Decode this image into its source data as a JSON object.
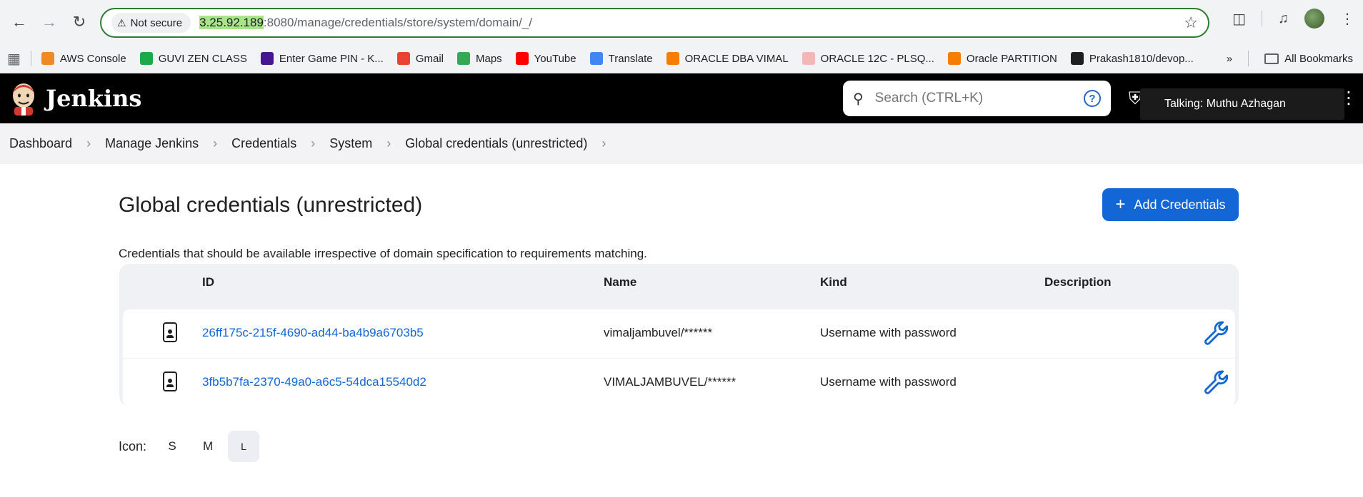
{
  "browser": {
    "security_label": "Not secure",
    "url_host": "3.25.92.189",
    "url_rest": ":8080/manage/credentials/store/system/domain/_/",
    "bookmarks": [
      {
        "label": "AWS Console",
        "icon": "aws-icon",
        "color": "#f08a24"
      },
      {
        "label": "GUVI ZEN CLASS",
        "icon": "guvi-icon",
        "color": "#1ba94c"
      },
      {
        "label": "Enter Game PIN - K...",
        "icon": "kahoot-icon",
        "color": "#46178f"
      },
      {
        "label": "Gmail",
        "icon": "gmail-icon",
        "color": "#ea4335"
      },
      {
        "label": "Maps",
        "icon": "maps-icon",
        "color": "#34a853"
      },
      {
        "label": "YouTube",
        "icon": "youtube-icon",
        "color": "#ff0000"
      },
      {
        "label": "Translate",
        "icon": "translate-icon",
        "color": "#4285f4"
      },
      {
        "label": "ORACLE DBA VIMAL",
        "icon": "blogger-icon",
        "color": "#f57d00"
      },
      {
        "label": "ORACLE 12C - PLSQ...",
        "icon": "pink-icon",
        "color": "#f4b6b6"
      },
      {
        "label": "Oracle PARTITION",
        "icon": "blogger-icon",
        "color": "#f57d00"
      },
      {
        "label": "Prakash1810/devop...",
        "icon": "github-icon",
        "color": "#1f1f1f"
      }
    ],
    "all_bookmarks_label": "All Bookmarks"
  },
  "jenkins": {
    "title": "Jenkins",
    "search_placeholder": "Search (CTRL+K)",
    "talking_popup": "Talking: Muthu Azhagan"
  },
  "breadcrumb": [
    "Dashboard",
    "Manage Jenkins",
    "Credentials",
    "System",
    "Global credentials (unrestricted)"
  ],
  "page": {
    "title": "Global credentials (unrestricted)",
    "add_button": "Add Credentials",
    "description": "Credentials that should be available irrespective of domain specification to requirements matching."
  },
  "table": {
    "headers": {
      "id": "ID",
      "name": "Name",
      "kind": "Kind",
      "description": "Description"
    },
    "rows": [
      {
        "id": "26ff175c-215f-4690-ad44-ba4b9a6703b5",
        "name": "vimaljambuvel/******",
        "kind": "Username with password",
        "description": ""
      },
      {
        "id": "3fb5b7fa-2370-49a0-a6c5-54dca15540d2",
        "name": "VIMALJAMBUVEL/******",
        "kind": "Username with password",
        "description": ""
      }
    ]
  },
  "icon_size": {
    "label": "Icon:",
    "options": [
      "S",
      "M",
      "L"
    ],
    "selected": "L"
  }
}
